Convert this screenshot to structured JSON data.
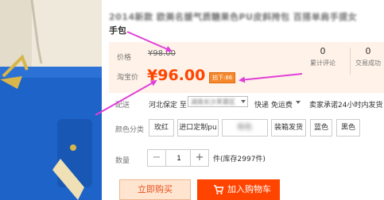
{
  "product": {
    "title_line1": "2014新款 欧美名媛气质糖果色PU皮斜挎包 百搭单肩手提女",
    "title_line2": "手包"
  },
  "price": {
    "orig_label": "价格",
    "orig_value": "¥98.00",
    "promo_label": "淘宝价",
    "promo_value": "¥96.00",
    "promo_badge": "拍下:86"
  },
  "stats": [
    {
      "num": "0",
      "label": "累计评论"
    },
    {
      "num": "0",
      "label": "交易成功"
    }
  ],
  "shipping": {
    "label": "配送",
    "from": "河北保定 至",
    "to": "湖南长沙芙蓉区",
    "option": "快递 免运费",
    "note": "卖家承诺24小时内发货"
  },
  "colors": {
    "label": "颜色分类",
    "options": [
      "玫红",
      "进口定制pu",
      "粉色",
      "装箱发货",
      "蓝色",
      "黑色"
    ]
  },
  "quantity": {
    "label": "数量",
    "minus": "−",
    "value": "1",
    "plus": "+",
    "stock": "件(库存2997件)"
  },
  "actions": {
    "buy_now": "立即购买",
    "add_cart": "加入购物车"
  },
  "colors_theme": {
    "accent": "#ff4400",
    "annotation": "#e040d8",
    "price_bg": "#fff2e8"
  }
}
